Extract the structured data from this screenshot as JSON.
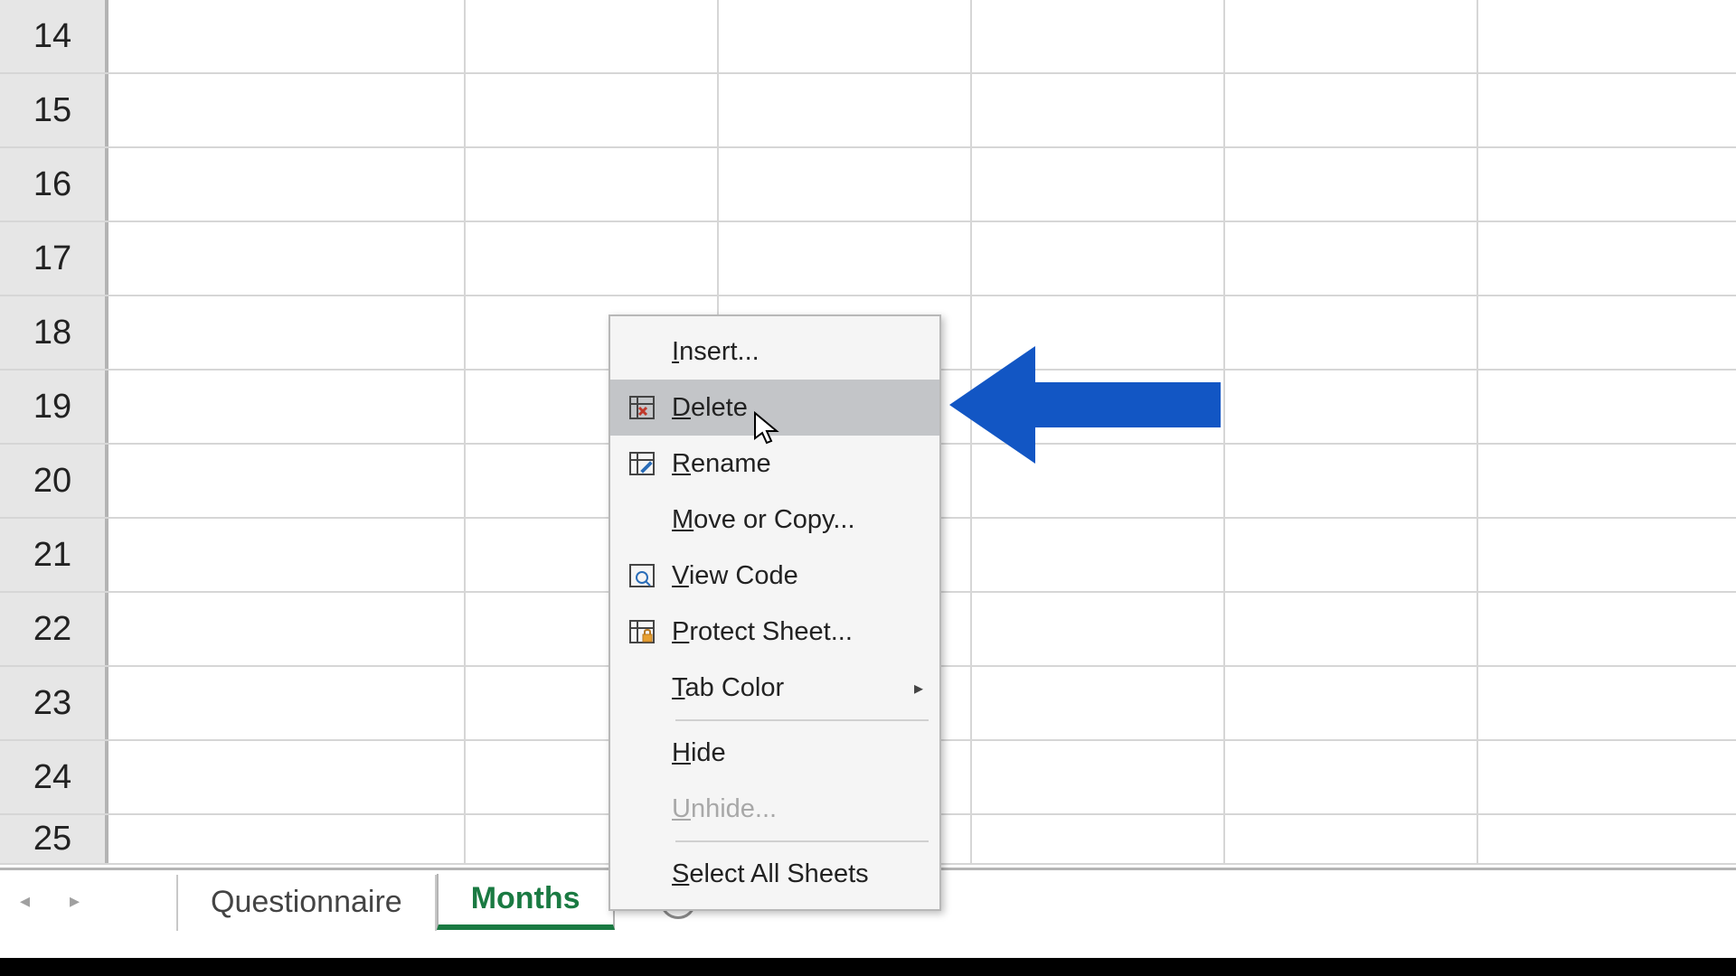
{
  "rows": [
    "14",
    "15",
    "16",
    "17",
    "18",
    "19",
    "20",
    "21",
    "22",
    "23",
    "24",
    "25"
  ],
  "tabs": {
    "tab1": "Questionnaire",
    "tab2": "Months"
  },
  "menu": {
    "insert": "Insert...",
    "delete": "Delete",
    "rename": "Rename",
    "move_copy": "Move or Copy...",
    "view_code": "View Code",
    "protect": "Protect Sheet...",
    "tab_color": "Tab Color",
    "hide": "Hide",
    "unhide": "Unhide...",
    "select_all": "Select All Sheets"
  },
  "arrow_color": "#1256c4"
}
